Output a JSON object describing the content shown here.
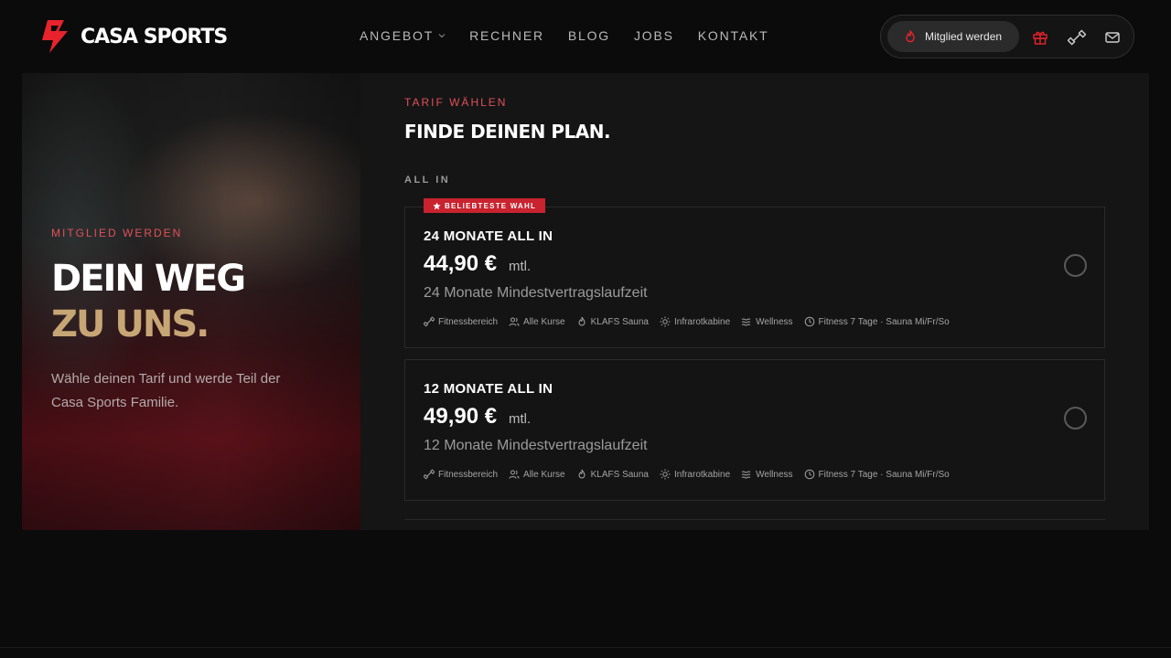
{
  "brand": {
    "name": "CASA SPORTS",
    "accent": "#e8232c",
    "gold": "#c7a676"
  },
  "nav": {
    "items": [
      {
        "label": "ANGEBOT",
        "has_dropdown": true
      },
      {
        "label": "RECHNER",
        "has_dropdown": false
      },
      {
        "label": "BLOG",
        "has_dropdown": false
      },
      {
        "label": "JOBS",
        "has_dropdown": false
      },
      {
        "label": "KONTAKT",
        "has_dropdown": false
      }
    ]
  },
  "header_actions": {
    "cta_label": "Mitglied werden",
    "cta_icon": "flame-icon",
    "icons": [
      "gift-icon",
      "dumbbell-icon",
      "mail-icon"
    ]
  },
  "hero": {
    "eyebrow": "MITGLIED WERDEN",
    "title_line1": "DEIN WEG",
    "title_line2": "ZU UNS.",
    "subtitle": "Wähle deinen Tarif und werde Teil der Casa Sports Familie."
  },
  "plans": {
    "eyebrow": "TARIF WÄHLEN",
    "title": "FINDE DEINEN PLAN.",
    "group_label": "ALL IN",
    "badge_label": "BELIEBTESTE WAHL",
    "items": [
      {
        "name": "24 MONATE ALL IN",
        "price": "44,90 €",
        "unit": "mtl.",
        "term": "24 Monate Mindestvertragslaufzeit",
        "selected": false,
        "features": [
          "Fitnessbereich",
          "Alle Kurse",
          "KLAFS Sauna",
          "Infrarotkabine",
          "Wellness",
          "Fitness 7 Tage · Sauna Mi/Fr/So"
        ]
      },
      {
        "name": "12 MONATE ALL IN",
        "price": "49,90 €",
        "unit": "mtl.",
        "term": "12 Monate Mindestvertragslaufzeit",
        "selected": false,
        "features": [
          "Fitnessbereich",
          "Alle Kurse",
          "KLAFS Sauna",
          "Infrarotkabine",
          "Wellness",
          "Fitness 7 Tage · Sauna Mi/Fr/So"
        ]
      }
    ]
  }
}
